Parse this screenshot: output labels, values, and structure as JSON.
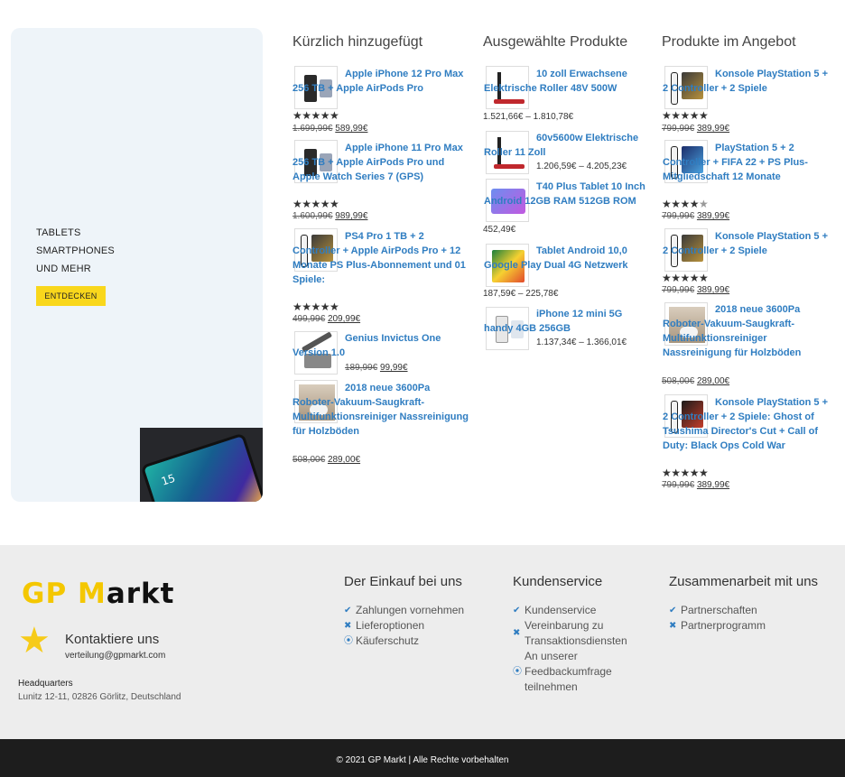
{
  "promo": {
    "lines": [
      "TABLETS",
      "SMARTPHONES",
      "UND MEHR"
    ],
    "button": "ENTDECKEN",
    "phone_clock": "15"
  },
  "columns": [
    {
      "heading": "Kürzlich hinzugefügt",
      "items": [
        {
          "title": "Apple iPhone 12 Pro Max 256 TB + Apple AirPods Pro",
          "rating": 5,
          "old": "1.699,99€",
          "new": "589,99€"
        },
        {
          "title": "Apple iPhone 11 Pro Max 256 TB + Apple AirPods Pro und Apple Watch Series 7 (GPS)",
          "rating": 5,
          "old": "1.600,99€",
          "new": "989,99€"
        },
        {
          "title": "PS4 Pro 1 TB + 2 Controller + Apple AirPods Pro + 12 Monate PS Plus-Abonnement und 01 Spiele:",
          "rating": 5,
          "old": "499,99€",
          "new": "209,99€"
        },
        {
          "title": "Genius Invictus One Version 1.0",
          "old": "189,99€",
          "new": "99,99€"
        },
        {
          "title": "2018 neue 3600Pa Roboter-Vakuum-Saugkraft-Multifunktionsreiniger Nassreinigung für Holzböden",
          "old": "508,00€",
          "new": "289,00€"
        }
      ]
    },
    {
      "heading": "Ausgewählte Produkte",
      "items": [
        {
          "title": "10 zoll Erwachsene Elektrische Roller 48V 500W",
          "range": "1.521,66€ – 1.810,78€"
        },
        {
          "title": "60v5600w Elektrische Roller 11 Zoll",
          "range": "1.206,59€ – 4.205,23€"
        },
        {
          "title": "T40 Plus Tablet 10 Inch Android 12GB RAM 512GB ROM",
          "range": "452,49€"
        },
        {
          "title": "Tablet Android 10,0 Google Play Dual 4G Netzwerk",
          "range": "187,59€ – 225,78€"
        },
        {
          "title": "iPhone 12 mini 5G handy 4GB 256GB",
          "range": "1.137,34€ – 1.366,01€"
        }
      ]
    },
    {
      "heading": "Produkte im Angebot",
      "items": [
        {
          "title": "Konsole PlayStation 5 + 2 Controller + 2 Spiele",
          "rating": 5,
          "old": "799,99€",
          "new": "389,99€"
        },
        {
          "title": "PlayStation 5 + 2 Controller + FIFA 22 + PS Plus-Mitgliedschaft 12 Monate",
          "rating": 4.5,
          "old": "799,99€",
          "new": "389,99€"
        },
        {
          "title": "Konsole PlayStation 5 + 2 Controller + 2 Spiele",
          "rating": 5,
          "old": "799,99€",
          "new": "389,99€"
        },
        {
          "title": "2018 neue 3600Pa Roboter-Vakuum-Saugkraft-Multifunktionsreiniger Nassreinigung für Holzböden",
          "old": "508,00€",
          "new": "289,00€"
        },
        {
          "title": "Konsole PlayStation 5 + 2 Controller + 2 Spiele: Ghost of Tsushima Director's Cut + Call of Duty: Black Ops Cold War",
          "rating": 5,
          "old": "799,99€",
          "new": "389,99€"
        }
      ]
    }
  ],
  "footer": {
    "logo_a": "GP",
    "logo_b": "M",
    "logo_c": "arkt",
    "contact_heading": "Kontaktiere uns",
    "contact_mail": "verteilung@gpmarkt.com",
    "hq_heading": "Headquarters",
    "hq_address": "Lunitz 12-11, 02826 Görlitz, Deutschland",
    "cols": [
      {
        "heading": "Der Einkauf bei uns",
        "items": [
          {
            "icon": "check",
            "label": "Zahlungen vornehmen"
          },
          {
            "icon": "cross",
            "label": "Lieferoptionen"
          },
          {
            "icon": "target",
            "label": "Käuferschutz"
          }
        ]
      },
      {
        "heading": "Kundenservice",
        "items": [
          {
            "icon": "check",
            "label": "Kundenservice"
          },
          {
            "icon": "cross",
            "label": "Vereinbarung zu Transaktionsdiensten"
          },
          {
            "icon": "none",
            "label": "An unserer"
          },
          {
            "icon": "target",
            "label": "Feedbackumfrage teilnehmen"
          }
        ]
      },
      {
        "heading": "Zusammenarbeit mit uns",
        "items": [
          {
            "icon": "check",
            "label": "Partnerschaften"
          },
          {
            "icon": "cross",
            "label": "Partnerprogramm"
          }
        ]
      }
    ],
    "copyright": "© 2021 GP Markt | Alle Rechte vorbehalten"
  }
}
